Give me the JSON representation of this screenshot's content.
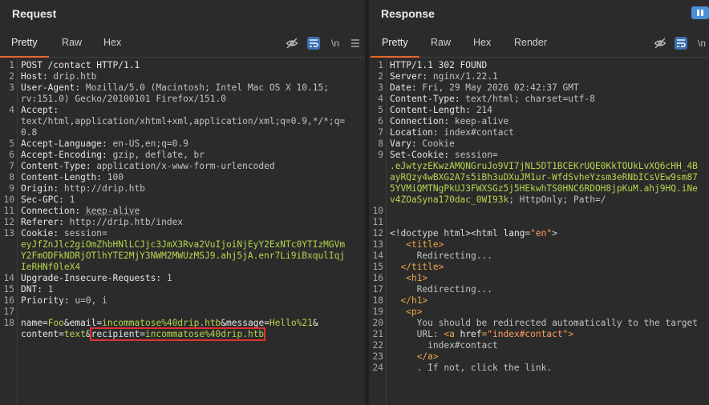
{
  "request": {
    "title": "Request",
    "tabs": [
      "Pretty",
      "Raw",
      "Hex"
    ],
    "active_tab": "Pretty",
    "tools": {
      "hide": "eye-off-icon",
      "wrap": "wrap-icon",
      "newline": "\\n",
      "menu": "menu-icon"
    },
    "lines": [
      {
        "n": "1",
        "parts": [
          {
            "t": "POST /contact HTTP/1.1",
            "c": "k"
          }
        ]
      },
      {
        "n": "2",
        "parts": [
          {
            "t": "Host: ",
            "c": "k"
          },
          {
            "t": "drip.htb",
            "c": "v"
          }
        ]
      },
      {
        "n": "3",
        "parts": [
          {
            "t": "User-Agent: ",
            "c": "k"
          },
          {
            "t": "Mozilla/5.0 (Macintosh; Intel Mac OS X 10.15;",
            "c": "v"
          }
        ]
      },
      {
        "n": "",
        "parts": [
          {
            "t": "rv:151.0) Gecko/20100101 Firefox/151.0",
            "c": "v"
          }
        ]
      },
      {
        "n": "4",
        "parts": [
          {
            "t": "Accept:",
            "c": "k"
          }
        ]
      },
      {
        "n": "",
        "parts": [
          {
            "t": "text/html,application/xhtml+xml,application/xml;q=0.9,*/*;q=",
            "c": "v"
          }
        ]
      },
      {
        "n": "",
        "parts": [
          {
            "t": "0.8",
            "c": "v"
          }
        ]
      },
      {
        "n": "5",
        "parts": [
          {
            "t": "Accept-Language: ",
            "c": "k"
          },
          {
            "t": "en-US,en;q=0.9",
            "c": "v"
          }
        ]
      },
      {
        "n": "6",
        "parts": [
          {
            "t": "Accept-Encoding: ",
            "c": "k"
          },
          {
            "t": "gzip, deflate, br",
            "c": "v"
          }
        ]
      },
      {
        "n": "7",
        "parts": [
          {
            "t": "Content-Type: ",
            "c": "k"
          },
          {
            "t": "application/x-www-form-urlencoded",
            "c": "v"
          }
        ]
      },
      {
        "n": "8",
        "parts": [
          {
            "t": "Content-Length: ",
            "c": "k"
          },
          {
            "t": "100",
            "c": "v"
          }
        ]
      },
      {
        "n": "9",
        "parts": [
          {
            "t": "Origin: ",
            "c": "k"
          },
          {
            "t": "http://drip.htb",
            "c": "v"
          }
        ]
      },
      {
        "n": "10",
        "parts": [
          {
            "t": "Sec-GPC: ",
            "c": "k"
          },
          {
            "t": "1",
            "c": "v"
          }
        ]
      },
      {
        "n": "11",
        "parts": [
          {
            "t": "Connection: ",
            "c": "k"
          },
          {
            "t": "keep-alive",
            "c": "v dotted"
          }
        ]
      },
      {
        "n": "12",
        "parts": [
          {
            "t": "Referer: ",
            "c": "k"
          },
          {
            "t": "http://drip.htb/index",
            "c": "v"
          }
        ]
      },
      {
        "n": "13",
        "parts": [
          {
            "t": "Cookie: ",
            "c": "k"
          },
          {
            "t": "session=",
            "c": "v"
          }
        ]
      },
      {
        "n": "",
        "parts": [
          {
            "t": "eyJfZnJlc2giOmZhbHNlLCJjc3JmX3Rva2VuIjoiNjEyY2ExNTc0YTIzMGVm",
            "c": "g"
          }
        ]
      },
      {
        "n": "",
        "parts": [
          {
            "t": "Y2FmODFkNDRjOTlhYTE2MjY3NWM2MWUzMSJ9.ahj5jA.enr7Li9iBxqulIqj",
            "c": "g"
          }
        ]
      },
      {
        "n": "",
        "parts": [
          {
            "t": "IeRHNf0leX4",
            "c": "g"
          }
        ]
      },
      {
        "n": "14",
        "parts": [
          {
            "t": "Upgrade-Insecure-Requests: ",
            "c": "k"
          },
          {
            "t": "1",
            "c": "v"
          }
        ]
      },
      {
        "n": "15",
        "parts": [
          {
            "t": "DNT: ",
            "c": "k"
          },
          {
            "t": "1",
            "c": "v"
          }
        ]
      },
      {
        "n": "16",
        "parts": [
          {
            "t": "Priority: ",
            "c": "k"
          },
          {
            "t": "u=0, i",
            "c": "v"
          }
        ]
      },
      {
        "n": "17",
        "parts": []
      },
      {
        "n": "18",
        "parts": [
          {
            "t": "name",
            "c": "k"
          },
          {
            "t": "=",
            "c": "k"
          },
          {
            "t": "Foo",
            "c": "g"
          },
          {
            "t": "&",
            "c": "k"
          },
          {
            "t": "email",
            "c": "k"
          },
          {
            "t": "=",
            "c": "k"
          },
          {
            "t": "incommatose%40drip.htb",
            "c": "g"
          },
          {
            "t": "&",
            "c": "k"
          },
          {
            "t": "message",
            "c": "k"
          },
          {
            "t": "=",
            "c": "k"
          },
          {
            "t": "Hello%21",
            "c": "g"
          },
          {
            "t": "&",
            "c": "k"
          }
        ]
      },
      {
        "n": "",
        "parts": [
          {
            "t": "content",
            "c": "k"
          },
          {
            "t": "=",
            "c": "k"
          },
          {
            "t": "text",
            "c": "g"
          },
          {
            "t": "&",
            "c": "k"
          },
          {
            "t": "recipient=incommatose%40drip.htb",
            "c": "hlseg"
          }
        ]
      }
    ]
  },
  "response": {
    "title": "Response",
    "tabs": [
      "Pretty",
      "Raw",
      "Hex",
      "Render"
    ],
    "active_tab": "Pretty",
    "tools": {
      "hide": "eye-off-icon",
      "wrap": "wrap-icon",
      "newline": "\\n"
    },
    "lines": [
      {
        "n": "1",
        "parts": [
          {
            "t": "HTTP/1.1 302 FOUND",
            "c": "k"
          }
        ]
      },
      {
        "n": "2",
        "parts": [
          {
            "t": "Server: ",
            "c": "k"
          },
          {
            "t": "nginx/1.22.1",
            "c": "v"
          }
        ]
      },
      {
        "n": "3",
        "parts": [
          {
            "t": "Date: ",
            "c": "k"
          },
          {
            "t": "Fri, 29 May 2026 02:42:37 GMT",
            "c": "v"
          }
        ]
      },
      {
        "n": "4",
        "parts": [
          {
            "t": "Content-Type: ",
            "c": "k"
          },
          {
            "t": "text/html; charset=utf-8",
            "c": "v"
          }
        ]
      },
      {
        "n": "5",
        "parts": [
          {
            "t": "Content-Length: ",
            "c": "k"
          },
          {
            "t": "214",
            "c": "v"
          }
        ]
      },
      {
        "n": "6",
        "parts": [
          {
            "t": "Connection: ",
            "c": "k"
          },
          {
            "t": "keep-alive",
            "c": "v"
          }
        ]
      },
      {
        "n": "7",
        "parts": [
          {
            "t": "Location: ",
            "c": "k"
          },
          {
            "t": "index#contact",
            "c": "v"
          }
        ]
      },
      {
        "n": "8",
        "parts": [
          {
            "t": "Vary: ",
            "c": "k"
          },
          {
            "t": "Cookie",
            "c": "v"
          }
        ]
      },
      {
        "n": "9",
        "parts": [
          {
            "t": "Set-Cookie: ",
            "c": "k"
          },
          {
            "t": "session=",
            "c": "v"
          }
        ]
      },
      {
        "n": "",
        "parts": [
          {
            "t": ".eJwtyzEKwzAMQNGruJo9VI7jNL5DT1BCEKrUQE0KkTOUkLvXQ6cHH_4B",
            "c": "g"
          }
        ]
      },
      {
        "n": "",
        "parts": [
          {
            "t": "ayRQzy4wBXG2A7s5iBh3uDXuJM1ur-WfdSvheYzsm3eRNbICsVEw9sm87",
            "c": "g"
          }
        ]
      },
      {
        "n": "",
        "parts": [
          {
            "t": "5YVMiQMTNgPkUJ3FWXSGz5j5HEkwhTS0HNC6RDOH8jpKuM.ahj9HQ.iNe",
            "c": "g"
          }
        ]
      },
      {
        "n": "",
        "parts": [
          {
            "t": "v4ZOaSyna170dac_0WI93k",
            "c": "g"
          },
          {
            "t": "; HttpOnly; Path=/",
            "c": "v"
          }
        ]
      },
      {
        "n": "10",
        "parts": []
      },
      {
        "n": "11",
        "parts": []
      },
      {
        "n": "12",
        "parts": [
          {
            "t": "<!doctype html>",
            "c": "tag"
          },
          {
            "t": "<html ",
            "c": "tag"
          },
          {
            "t": "lang",
            "c": "attr"
          },
          {
            "t": "=",
            "c": "tag"
          },
          {
            "t": "\"en\"",
            "c": "str"
          },
          {
            "t": ">",
            "c": "tag"
          }
        ]
      },
      {
        "n": "13",
        "parts": [
          {
            "t": "   ",
            "c": "v"
          },
          {
            "t": "<title>",
            "c": "o"
          }
        ]
      },
      {
        "n": "14",
        "parts": [
          {
            "t": "     Redirecting...",
            "c": "v"
          }
        ]
      },
      {
        "n": "15",
        "parts": [
          {
            "t": "  ",
            "c": "v"
          },
          {
            "t": "</title>",
            "c": "o"
          }
        ]
      },
      {
        "n": "16",
        "parts": [
          {
            "t": "   ",
            "c": "v"
          },
          {
            "t": "<h1>",
            "c": "o"
          }
        ]
      },
      {
        "n": "17",
        "parts": [
          {
            "t": "     Redirecting...",
            "c": "v"
          }
        ]
      },
      {
        "n": "18",
        "parts": [
          {
            "t": "  ",
            "c": "v"
          },
          {
            "t": "</h1>",
            "c": "o"
          }
        ]
      },
      {
        "n": "19",
        "parts": [
          {
            "t": "   ",
            "c": "v"
          },
          {
            "t": "<p>",
            "c": "o"
          }
        ]
      },
      {
        "n": "20",
        "parts": [
          {
            "t": "     You should be redirected automatically to the target",
            "c": "v"
          }
        ]
      },
      {
        "n": "21",
        "parts": [
          {
            "t": "     URL: ",
            "c": "v"
          },
          {
            "t": "<a ",
            "c": "o"
          },
          {
            "t": "href",
            "c": "attr"
          },
          {
            "t": "=",
            "c": "o"
          },
          {
            "t": "\"index#contact\"",
            "c": "str"
          },
          {
            "t": ">",
            "c": "o"
          }
        ]
      },
      {
        "n": "22",
        "parts": [
          {
            "t": "       index#contact",
            "c": "v"
          }
        ]
      },
      {
        "n": "23",
        "parts": [
          {
            "t": "     ",
            "c": "v"
          },
          {
            "t": "</a>",
            "c": "o"
          }
        ]
      },
      {
        "n": "24",
        "parts": [
          {
            "t": "     . If not, click the link.",
            "c": "v"
          }
        ]
      }
    ]
  }
}
